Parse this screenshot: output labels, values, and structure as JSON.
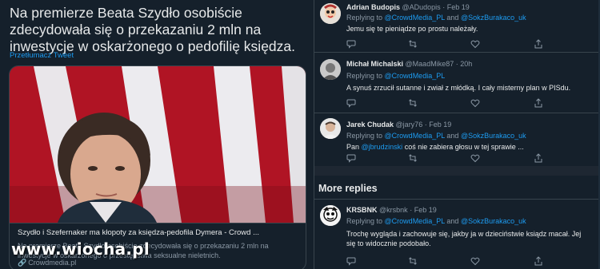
{
  "main_tweet": {
    "text": "Na premierze Beata Szydło osobiście zdecydowała się o przekazaniu 2 mln na inwestycje w oskarżonego o pedofilię księdza.",
    "translate_label": "Przetłumacz Tweet",
    "card": {
      "title": "Szydło i Szefernaker ma kłopoty za księdza-pedofila Dymera - Crowd ...",
      "description": "Na premierze Beata Szydło osobiście zdecydowała się o przekazaniu 2 mln na inwestycje w oskarżonego o przestępstwa seksualne nieletnich.",
      "domain": "Crowdmedia.pl"
    }
  },
  "watermark": "www.wiocha.pl",
  "replies": [
    {
      "name": "Adrian Budopis",
      "handle": "@ADudopis",
      "dot": "·",
      "time": "Feb 19",
      "replying_prefix": "Replying to",
      "replying_to_1": "@CrowdMedia_PL",
      "replying_and": "and",
      "replying_to_2": "@SokzBurakaco_uk",
      "text": "Jemu się te pieniądze po prostu należały."
    },
    {
      "name": "Michał Michalski",
      "handle": "@MaadMike87",
      "dot": "·",
      "time": "20h",
      "replying_prefix": "Replying to",
      "replying_to_1": "@CrowdMedia_PL",
      "text": "A synuś zrzucił sutanne i zwiał z młódką. I cały misterny plan w PISdu."
    },
    {
      "name": "Jarek Chudak",
      "handle": "@jary76",
      "dot": "·",
      "time": "Feb 19",
      "replying_prefix": "Replying to",
      "replying_to_1": "@CrowdMedia_PL",
      "replying_and": "and",
      "replying_to_2": "@SokzBurakaco_uk",
      "text_prefix": "Pan",
      "text_mention": "@jbrudzinski",
      "text_suffix": "coś nie zabiera głosu w tej sprawie ..."
    },
    {
      "name": "KRSBNK",
      "handle": "@krsbnk",
      "dot": "·",
      "time": "Feb 19",
      "replying_prefix": "Replying to",
      "replying_to_1": "@CrowdMedia_PL",
      "replying_and": "and",
      "replying_to_2": "@SokzBurakaco_uk",
      "text": "Trochę wygląda i zachowuje się, jakby ja w dzieciństwie ksiądz macał. Jej się to widocznie podobało."
    }
  ],
  "more_replies_label": "More replies",
  "icons": [
    "reply-icon",
    "retweet-icon",
    "like-icon",
    "share-icon",
    "link-icon"
  ],
  "colors": {
    "background": "#15202b",
    "accent": "#1d9bf0",
    "secondary_text": "#8b98a5",
    "border": "#38444d",
    "flag_red": "#c8102e"
  }
}
